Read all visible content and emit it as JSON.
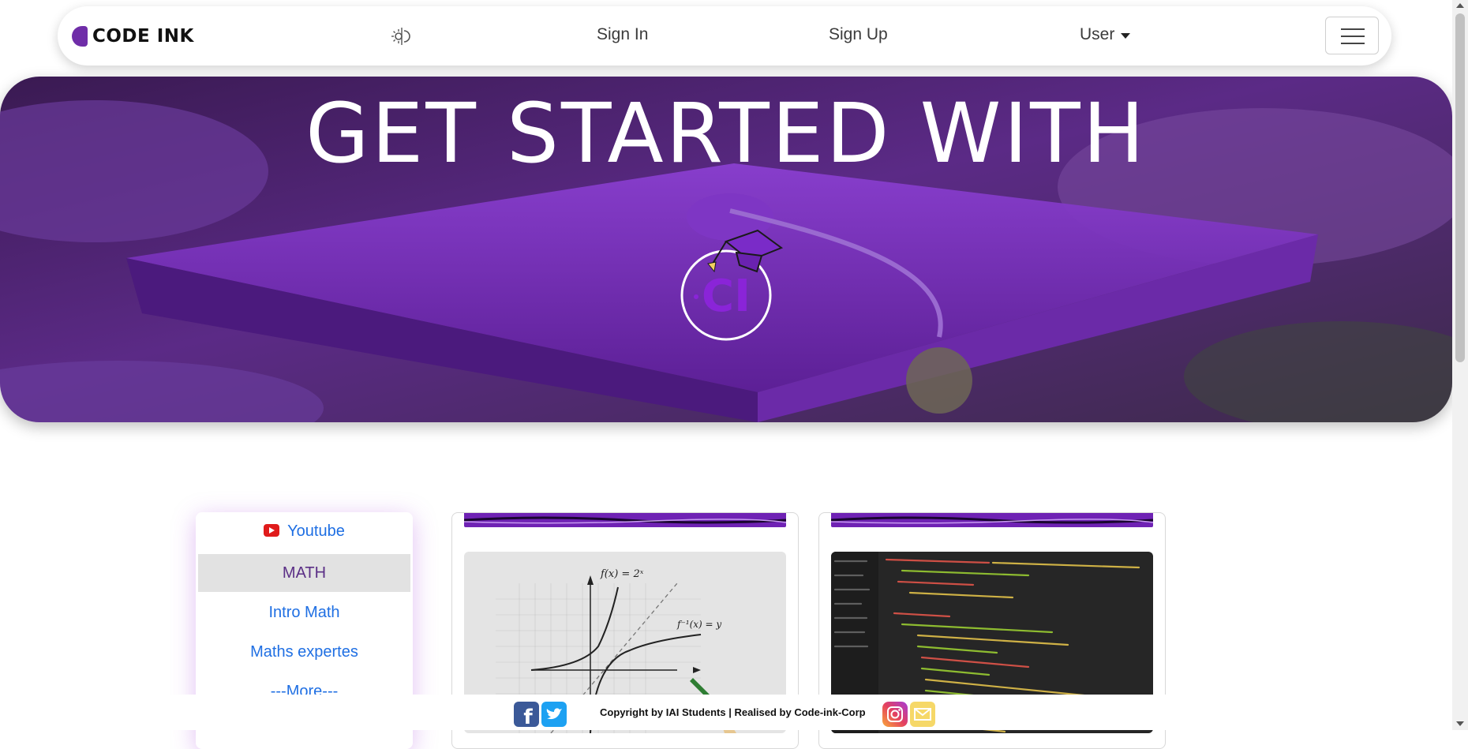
{
  "navbar": {
    "brand": "CODE INK",
    "theme_toggle_icon": "sun-moon-icon",
    "sign_in": "Sign In",
    "sign_up": "Sign Up",
    "user": "User",
    "menu_icon": "hamburger-menu-icon"
  },
  "hero": {
    "title": "GET STARTED WITH",
    "logo_text": "CI",
    "accent_color": "#7b1fb8"
  },
  "sidebar": {
    "items": [
      {
        "label": "Youtube",
        "icon": "youtube-icon"
      },
      {
        "label": "MATH"
      },
      {
        "label": "Intro Math"
      },
      {
        "label": "Maths expertes"
      },
      {
        "label": "---More---"
      }
    ]
  },
  "cards": [
    {
      "image": "math-graph-image",
      "graph_labels": [
        "f(x) = 2ˣ",
        "f⁻¹(x) = y"
      ]
    },
    {
      "image": "code-editor-image"
    }
  ],
  "footer": {
    "copyright": "Copyright by IAI Students | Realised by Code-ink-Corp",
    "icons": [
      "facebook-icon",
      "twitter-icon",
      "instagram-icon",
      "mail-icon"
    ]
  }
}
